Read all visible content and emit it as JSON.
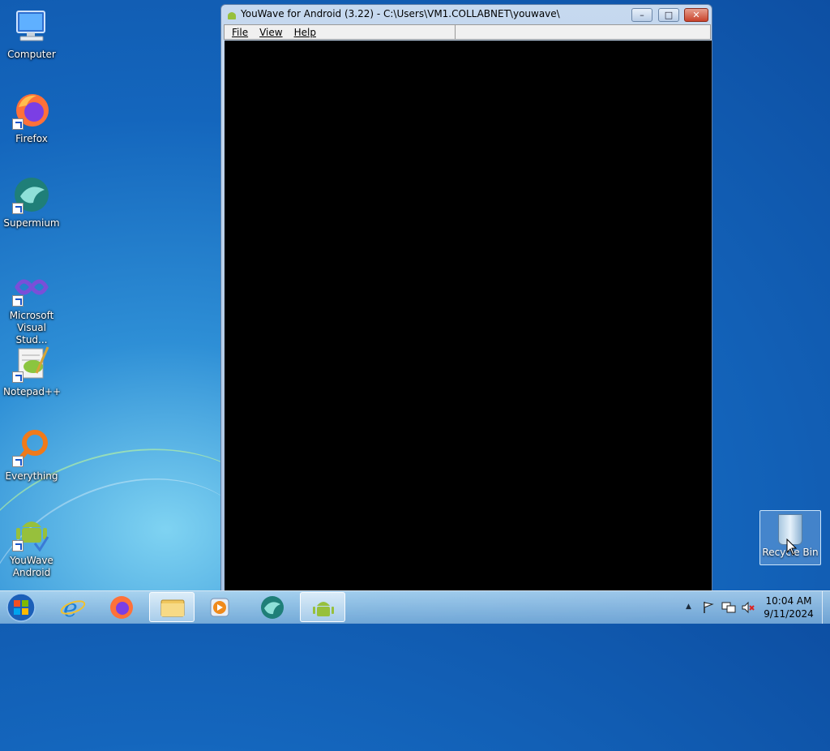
{
  "desktop": {
    "icons": [
      {
        "label": "Computer"
      },
      {
        "label": "Firefox"
      },
      {
        "label": "Supermium"
      },
      {
        "label": "Microsoft Visual Stud..."
      },
      {
        "label": "Notepad++"
      },
      {
        "label": "Everything"
      },
      {
        "label": "YouWave Android"
      }
    ],
    "recycle_bin": {
      "label": "Recycle Bin"
    }
  },
  "window": {
    "title": "YouWave for Android (3.22) - C:\\Users\\VM1.COLLABNET\\youwave\\",
    "menu": {
      "file": "File",
      "view": "View",
      "help": "Help"
    },
    "controls": {
      "minimize": "–",
      "maximize": "□",
      "close": "✕"
    }
  },
  "taskbar": {
    "pinned": [
      {
        "icon": "internet-explorer-icon"
      },
      {
        "icon": "firefox-icon"
      },
      {
        "icon": "file-explorer-icon"
      },
      {
        "icon": "media-player-icon"
      },
      {
        "icon": "supermium-icon"
      },
      {
        "icon": "youwave-android-icon"
      }
    ],
    "tray": {
      "show_hidden": "▲"
    },
    "clock": {
      "time": "10:04 AM",
      "date": "9/11/2024"
    }
  }
}
